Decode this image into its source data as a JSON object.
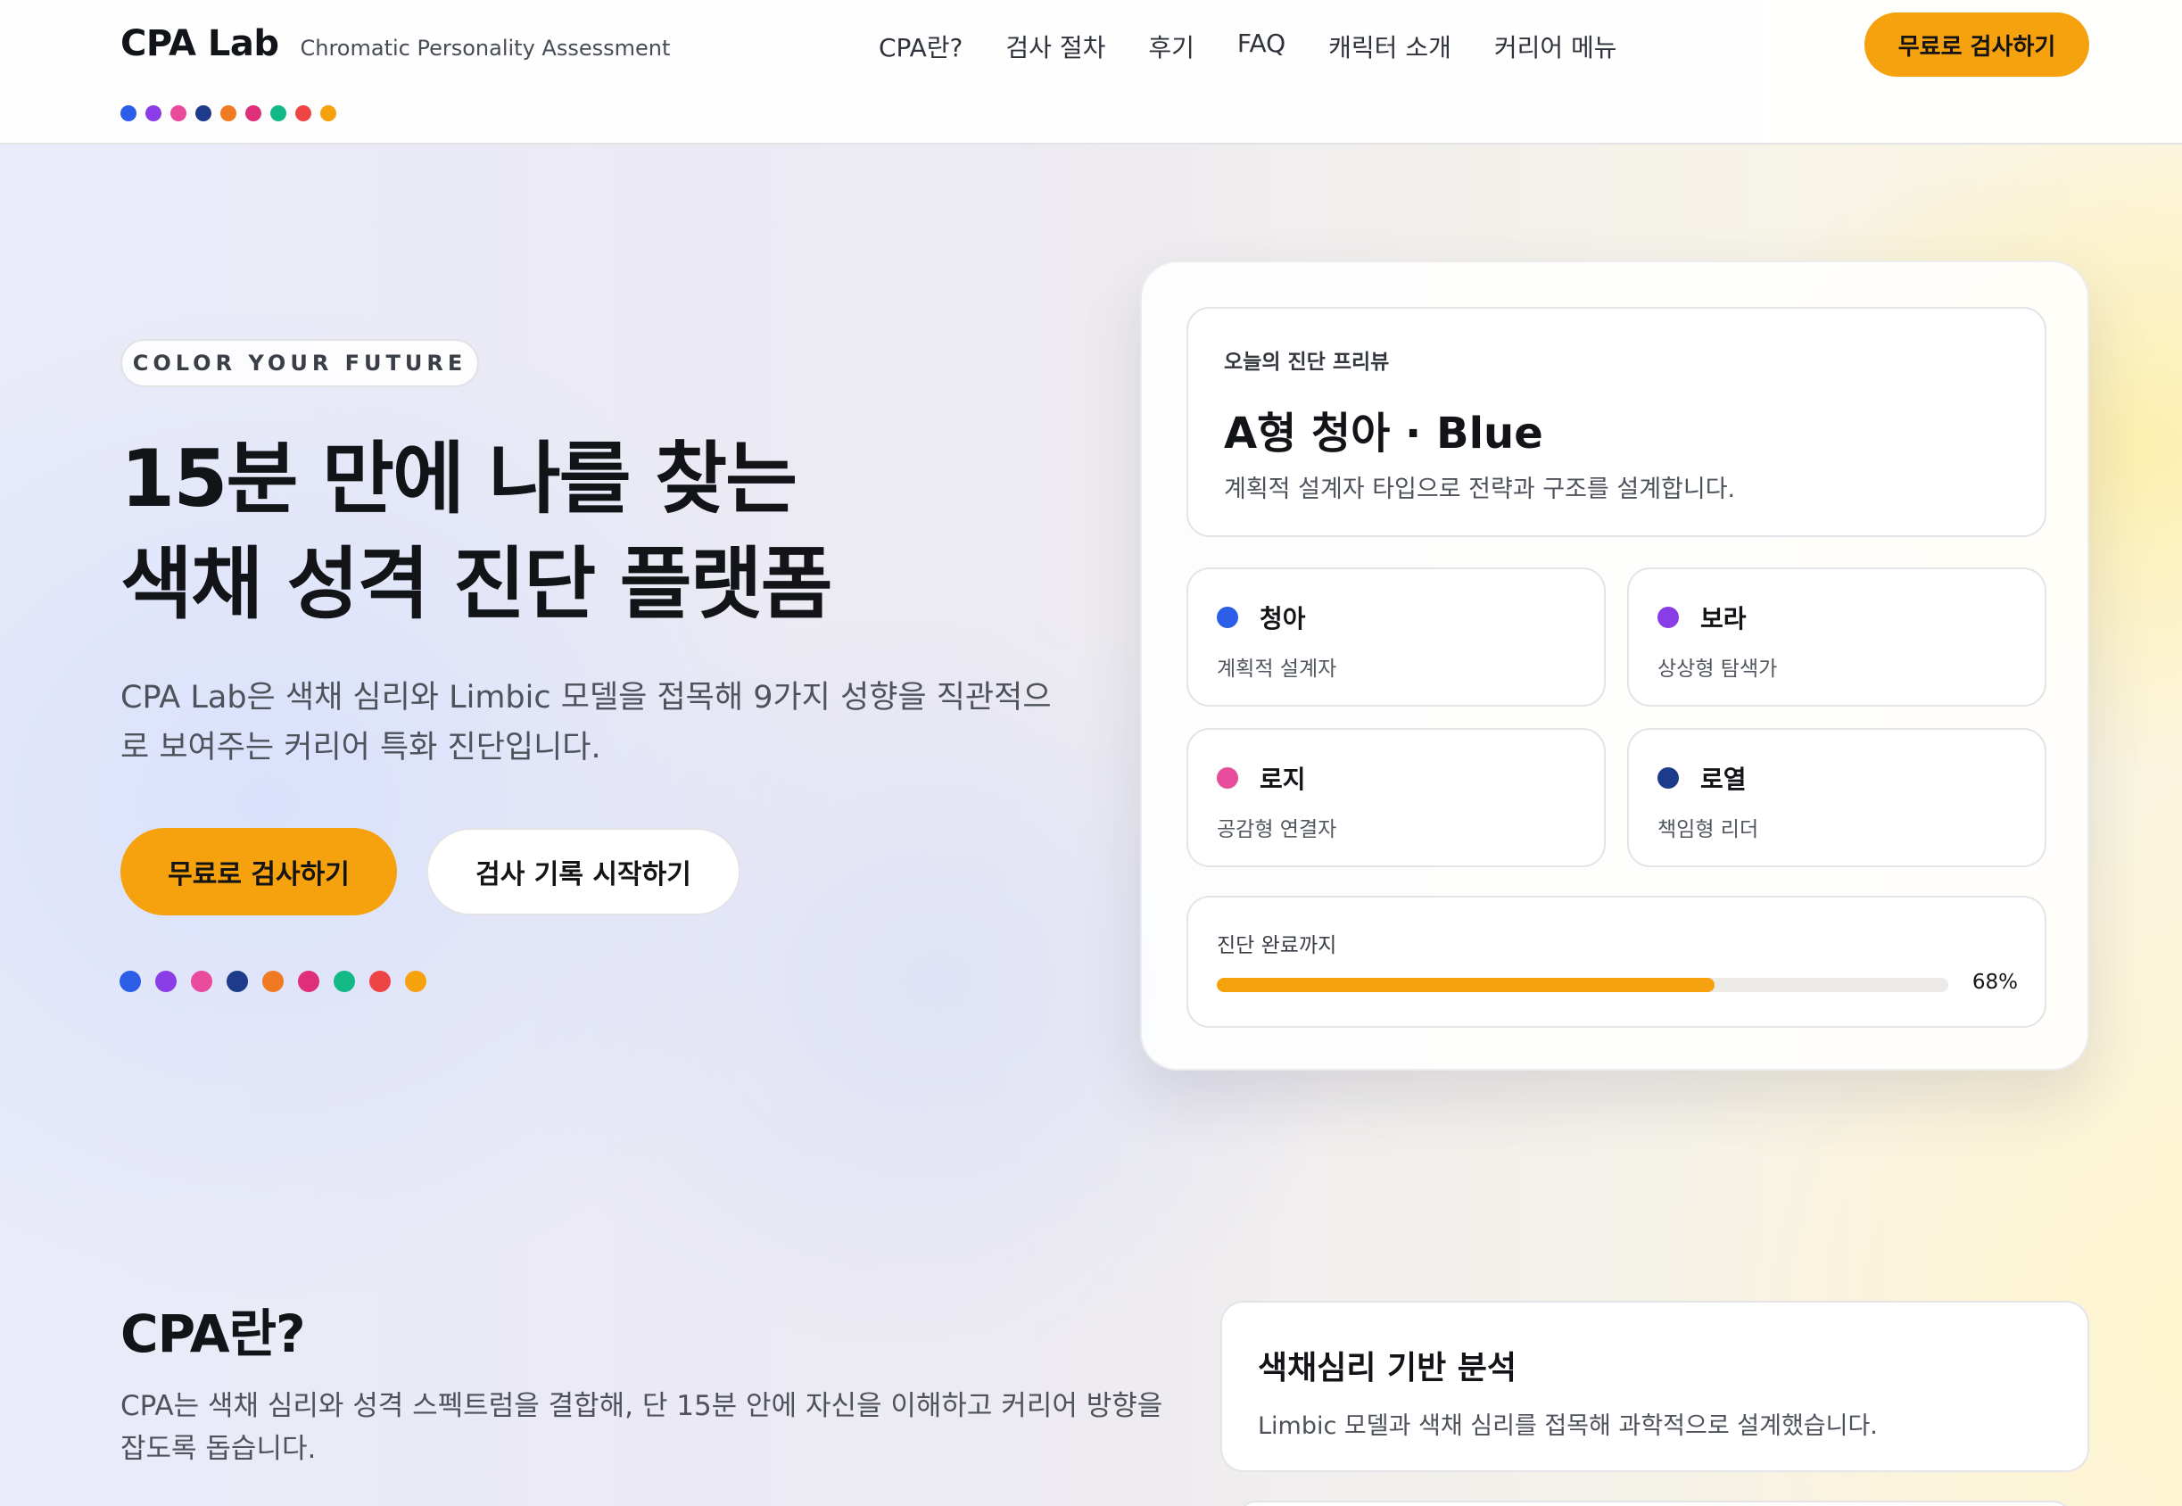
{
  "colors": {
    "accent": "#f5a20e",
    "palette": [
      "#2b5de6",
      "#8a3ce6",
      "#e84a9c",
      "#1e3a8a",
      "#f07a22",
      "#de2f78",
      "#12b886",
      "#ef4444",
      "#f5a20e"
    ]
  },
  "header": {
    "brand_name": "CPA Lab",
    "brand_subtitle": "Chromatic Personality Assessment",
    "nav": [
      "CPA란?",
      "검사 절차",
      "후기",
      "FAQ",
      "캐릭터 소개",
      "커리어 메뉴"
    ],
    "cta_label": "무료로 검사하기"
  },
  "hero": {
    "tagline": "COLOR YOUR FUTURE",
    "title_line1": "15분 만에 나를 찾는",
    "title_line2": "색채 성격 진단 플랫폼",
    "description": "CPA Lab은 색채 심리와 Limbic 모델을 접목해 9가지 성향을 직관적으로 보여주는 커리어 특화 진단입니다.",
    "primary_button": "무료로 검사하기",
    "secondary_button": "검사 기록 시작하기"
  },
  "preview": {
    "label": "오늘의 진단 프리뷰",
    "title": "A형 청아 · Blue",
    "description": "계획적 설계자 타입으로 전략과 구조를 설계합니다.",
    "types": [
      {
        "name": "청아",
        "role": "계획적 설계자",
        "color": "#2b5de6"
      },
      {
        "name": "보라",
        "role": "상상형 탐색가",
        "color": "#8a3ce6"
      },
      {
        "name": "로지",
        "role": "공감형 연결자",
        "color": "#e84a9c"
      },
      {
        "name": "로열",
        "role": "책임형 리더",
        "color": "#1e3a8a"
      }
    ],
    "progress_label": "진단 완료까지",
    "progress_value": 68,
    "progress_text": "68%"
  },
  "about": {
    "title": "CPA란?",
    "description": "CPA는 색채 심리와 성격 스펙트럼을 결합해, 단 15분 안에 자신을 이해하고 커리어 방향을 잡도록 돕습니다.",
    "feature_title": "색채심리 기반 분석",
    "feature_desc": "Limbic 모델과 색채 심리를 접목해 과학적으로 설계했습니다."
  }
}
